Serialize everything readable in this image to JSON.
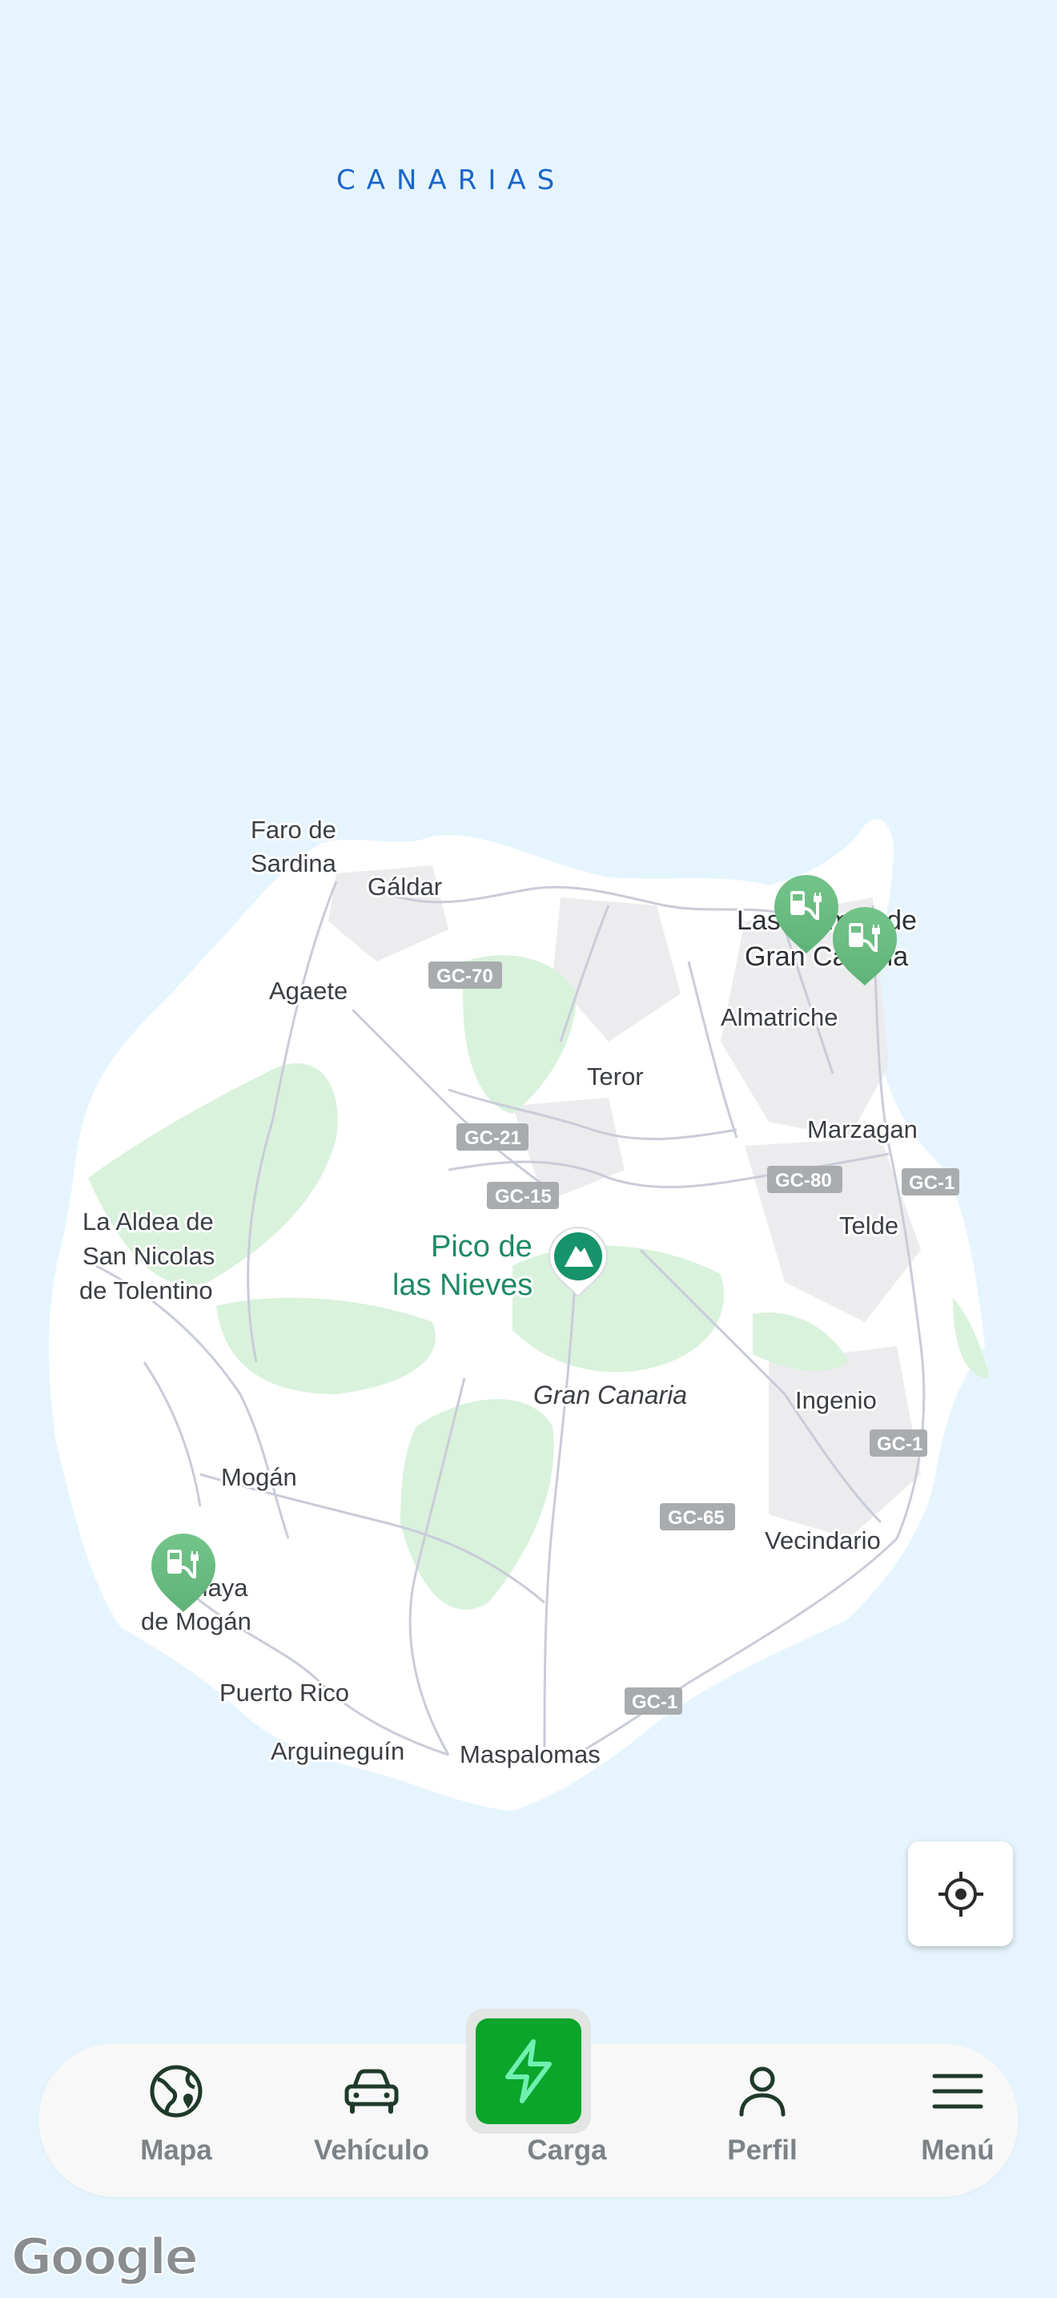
{
  "map": {
    "sea_label": "CANARIAS",
    "island_label": "Gran Canaria",
    "peak": {
      "line1": "Pico de",
      "line2": "las Nieves",
      "icon": "mountain-icon"
    },
    "places": {
      "faro_sardina": [
        "Faro de",
        "Sardina"
      ],
      "galdar": "Gáldar",
      "agaete": "Agaete",
      "las_palmas": [
        "Las Palmas de",
        "Gran Canaria"
      ],
      "almatriche": "Almatriche",
      "teror": "Teror",
      "marzagan": "Marzagan",
      "telde": "Telde",
      "la_aldea": [
        "La Aldea de",
        "San Nicolas",
        "de Tolentino"
      ],
      "ingenio": "Ingenio",
      "mogan": "Mogán",
      "vecindario": "Vecindario",
      "playa_mogan": [
        "Playa",
        "de Mogán"
      ],
      "puerto_rico": "Puerto Rico",
      "arguineguin": "Arguineguín",
      "maspalomas": "Maspalomas"
    },
    "roads": {
      "gc70": "GC-70",
      "gc21": "GC-21",
      "gc15": "GC-15",
      "gc80": "GC-80",
      "gc1_north": "GC-1",
      "gc1_east": "GC-1",
      "gc65": "GC-65",
      "gc1_south": "GC-1"
    },
    "charger_icon": "ev-charger-icon",
    "attribution": "Google"
  },
  "locate_button": {
    "icon": "crosshair-locate-icon"
  },
  "nav": {
    "items": [
      {
        "label": "Mapa",
        "icon": "map-globe-icon"
      },
      {
        "label": "Vehículo",
        "icon": "car-icon"
      },
      {
        "label": "Carga",
        "icon": "lightning-bolt-icon"
      },
      {
        "label": "Perfil",
        "icon": "person-icon"
      },
      {
        "label": "Menú",
        "icon": "hamburger-menu-icon"
      }
    ],
    "colors": {
      "active": "#0aa52a",
      "icon": "#1f3a2a",
      "label": "#7c8286"
    }
  }
}
